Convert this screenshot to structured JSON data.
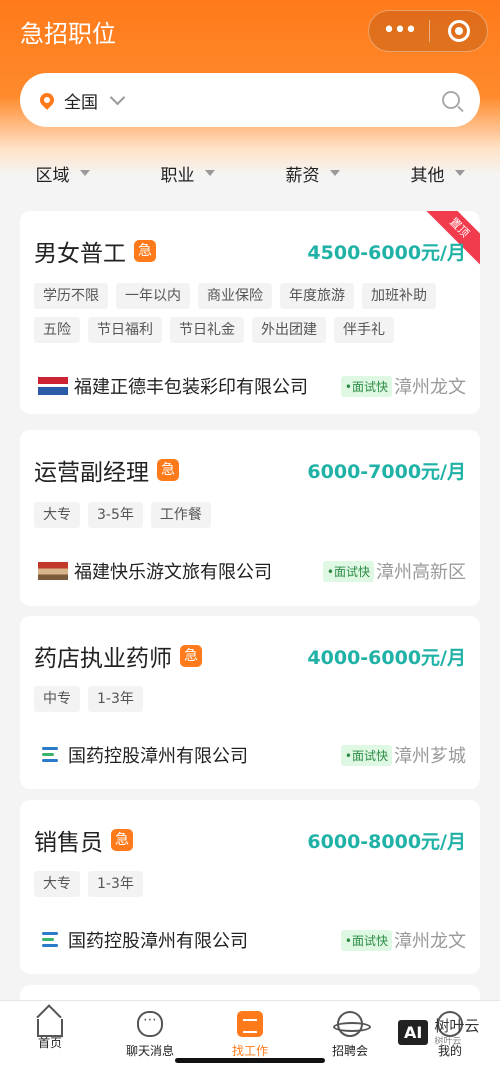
{
  "header": {
    "title": "急招职位",
    "menu_glyph": "•••"
  },
  "search": {
    "location": "全国"
  },
  "filters": [
    {
      "label": "区域"
    },
    {
      "label": "职业"
    },
    {
      "label": "薪资"
    },
    {
      "label": "其他"
    }
  ],
  "jobs": [
    {
      "title": "男女普工",
      "urgent": "急",
      "salary": "4500-6000元/月",
      "pinned": "置顶",
      "tags": [
        "学历不限",
        "一年以内",
        "商业保险",
        "年度旅游",
        "加班补助",
        "五险",
        "节日福利",
        "节日礼金",
        "外出团建",
        "伴手礼"
      ],
      "company": "福建正德丰包装彩印有限公司",
      "badge": "•面试快",
      "area": "漳州龙文"
    },
    {
      "title": "运营副经理",
      "urgent": "急",
      "salary": "6000-7000元/月",
      "tags": [
        "大专",
        "3-5年",
        "工作餐"
      ],
      "company": "福建快乐游文旅有限公司",
      "badge": "•面试快",
      "area": "漳州高新区"
    },
    {
      "title": "药店执业药师",
      "urgent": "急",
      "salary": "4000-6000元/月",
      "tags": [
        "中专",
        "1-3年"
      ],
      "company": "国药控股漳州有限公司",
      "badge": "•面试快",
      "area": "漳州芗城"
    },
    {
      "title": "销售员",
      "urgent": "急",
      "salary": "6000-8000元/月",
      "tags": [
        "大专",
        "1-3年"
      ],
      "company": "国药控股漳州有限公司",
      "badge": "•面试快",
      "area": "漳州龙文"
    }
  ],
  "tabbar": [
    {
      "label": "首页"
    },
    {
      "label": "聊天消息"
    },
    {
      "label": "找工作"
    },
    {
      "label": "招聘会"
    },
    {
      "label": "我的"
    }
  ],
  "watermark": {
    "ai": "AI",
    "name": "树叶云",
    "sub": "树叶云"
  },
  "colors": {
    "brand": "#ff7a1a",
    "salary": "#20b2a6",
    "badge_bg": "#dff8e4",
    "ribbon": "#f23c4e"
  }
}
